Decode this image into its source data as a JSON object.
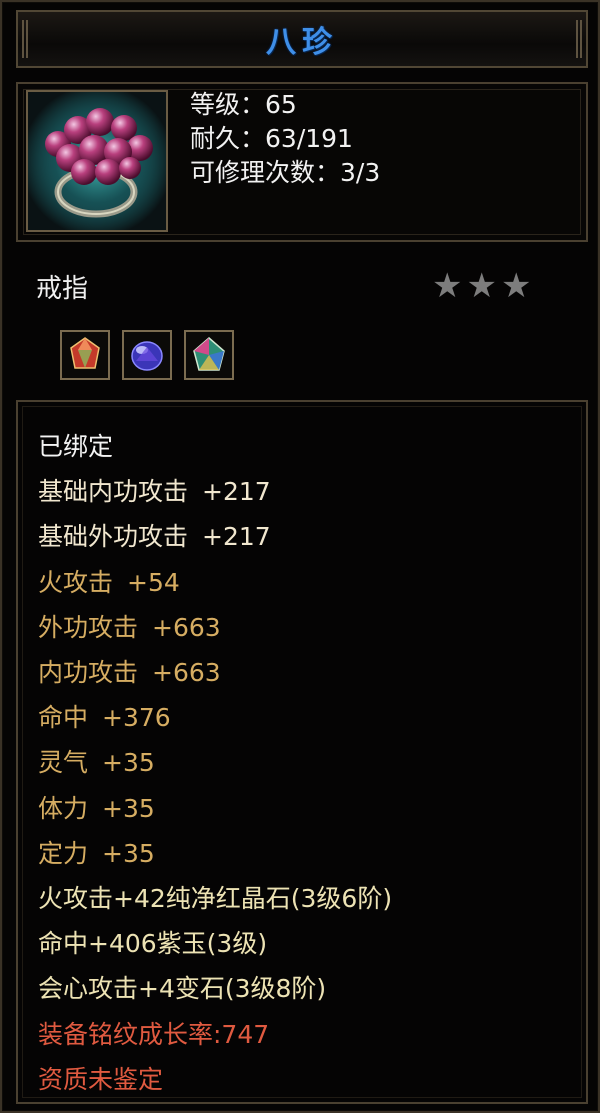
{
  "item": {
    "name": "八珍",
    "level_label": "等级：",
    "level": "65",
    "durability_label": "耐久：",
    "durability": "63/191",
    "repair_label": "可修理次数：",
    "repair": "3/3",
    "type": "戒指",
    "star_count": 3,
    "star_color": "#7d7d7d"
  },
  "gems": [
    {
      "name": "red-gem-icon"
    },
    {
      "name": "purple-gem-icon"
    },
    {
      "name": "variegated-gem-icon"
    }
  ],
  "attributes": {
    "bound": "已绑定",
    "base_inner_attack": {
      "label": "基础内功攻击",
      "value": "+217"
    },
    "base_outer_attack": {
      "label": "基础外功攻击",
      "value": "+217"
    },
    "fire_attack": {
      "label": "火攻击",
      "value": "+54"
    },
    "outer_attack": {
      "label": "外功攻击",
      "value": "+663"
    },
    "inner_attack": {
      "label": "内功攻击",
      "value": "+663"
    },
    "hit": {
      "label": "命中",
      "value": "+376"
    },
    "spirit": {
      "label": "灵气",
      "value": "+35"
    },
    "stamina": {
      "label": "体力",
      "value": "+35"
    },
    "focus": {
      "label": "定力",
      "value": "+35"
    },
    "gem_line_1": "火攻击+42纯净红晶石(3级6阶)",
    "gem_line_2": "命中+406紫玉(3级)",
    "gem_line_3": "会心攻击+4变石(3级8阶)",
    "growth": "装备铭纹成长率:747",
    "quality": "资质未鉴定"
  },
  "colors": {
    "title": "#3f8fe8",
    "white": "#f4f4f4",
    "gold": "#d6ad62",
    "red": "#e05a40"
  }
}
